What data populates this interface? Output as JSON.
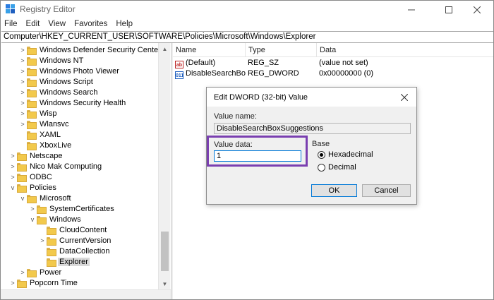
{
  "window": {
    "title": "Registry Editor"
  },
  "menu": [
    "File",
    "Edit",
    "View",
    "Favorites",
    "Help"
  ],
  "address": "Computer\\HKEY_CURRENT_USER\\SOFTWARE\\Policies\\Microsoft\\Windows\\Explorer",
  "tree": [
    {
      "label": "Windows Defender Security Center",
      "expander": ">"
    },
    {
      "label": "Windows NT",
      "expander": ">"
    },
    {
      "label": "Windows Photo Viewer",
      "expander": ">"
    },
    {
      "label": "Windows Script",
      "expander": ">"
    },
    {
      "label": "Windows Search",
      "expander": ">"
    },
    {
      "label": "Windows Security Health",
      "expander": ">"
    },
    {
      "label": "Wisp",
      "expander": ">"
    },
    {
      "label": "Wlansvc",
      "expander": ">"
    },
    {
      "label": "XAML",
      "expander": ""
    },
    {
      "label": "XboxLive",
      "expander": ""
    },
    {
      "label": "Netscape",
      "expander": ">"
    },
    {
      "label": "Nico Mak Computing",
      "expander": ">"
    },
    {
      "label": "ODBC",
      "expander": ">"
    },
    {
      "label": "Policies",
      "expander": "v"
    },
    {
      "label": "Microsoft",
      "expander": "v"
    },
    {
      "label": "SystemCertificates",
      "expander": ">"
    },
    {
      "label": "Windows",
      "expander": "v"
    },
    {
      "label": "CloudContent",
      "expander": ""
    },
    {
      "label": "CurrentVersion",
      "expander": ">"
    },
    {
      "label": "DataCollection",
      "expander": ""
    },
    {
      "label": "Explorer",
      "expander": ""
    },
    {
      "label": "Power",
      "expander": ">"
    },
    {
      "label": "Popcorn Time",
      "expander": ">"
    }
  ],
  "list": {
    "columns": [
      "Name",
      "Type",
      "Data"
    ],
    "rows": [
      {
        "name": "(Default)",
        "type": "REG_SZ",
        "data": "(value not set)",
        "icon": "ab"
      },
      {
        "name": "DisableSearchBo...",
        "type": "REG_DWORD",
        "data": "0x00000000 (0)",
        "icon": "011"
      }
    ]
  },
  "dialog": {
    "title": "Edit DWORD (32-bit) Value",
    "value_name_label": "Value name:",
    "value_name": "DisableSearchBoxSuggestions",
    "value_data_label": "Value data:",
    "value_data": "1",
    "base_label": "Base",
    "hex_label": "Hexadecimal",
    "dec_label": "Decimal",
    "selected_base": "Hexadecimal",
    "ok_label": "OK",
    "cancel_label": "Cancel"
  },
  "colors": {
    "highlight_border": "#7a3fb0",
    "focus_blue": "#0078d7"
  }
}
